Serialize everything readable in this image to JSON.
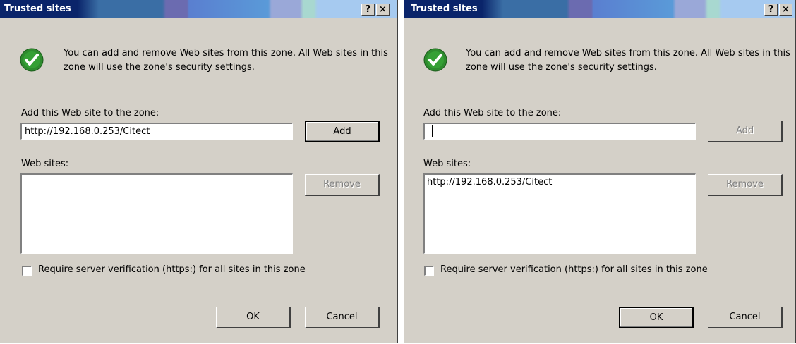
{
  "dialogs": [
    {
      "title": "Trusted sites",
      "help_button": "?",
      "close_button": "×",
      "info_text": "You can add and remove Web sites from this zone. All Web sites in this zone will use the zone's security settings.",
      "add_label": "Add this Web site to the zone:",
      "add_value": "http://192.168.0.253/Citect",
      "add_button": "Add",
      "websites_label": "Web sites:",
      "websites": [],
      "remove_button": "Remove",
      "require_https_label": "Require server verification (https:) for all sites in this zone",
      "require_https_checked": false,
      "ok_button": "OK",
      "cancel_button": "Cancel"
    },
    {
      "title": "Trusted sites",
      "help_button": "?",
      "close_button": "×",
      "info_text": "You can add and remove Web sites from this zone. All Web sites in this zone will use the zone's security settings.",
      "add_label": "Add this Web site to the zone:",
      "add_value": "",
      "add_button": "Add",
      "websites_label": "Web sites:",
      "websites": [
        "http://192.168.0.253/Citect"
      ],
      "remove_button": "Remove",
      "require_https_label": "Require server verification (https:) for all sites in this zone",
      "require_https_checked": false,
      "ok_button": "OK",
      "cancel_button": "Cancel"
    }
  ],
  "colors": {
    "dialog_bg": "#d4d0c8",
    "title_text": "#ffffff",
    "check_green": "#2e8b2e"
  },
  "icons": {
    "zone_icon": "green-checkmark-icon",
    "help": "help-icon",
    "close": "close-icon"
  }
}
